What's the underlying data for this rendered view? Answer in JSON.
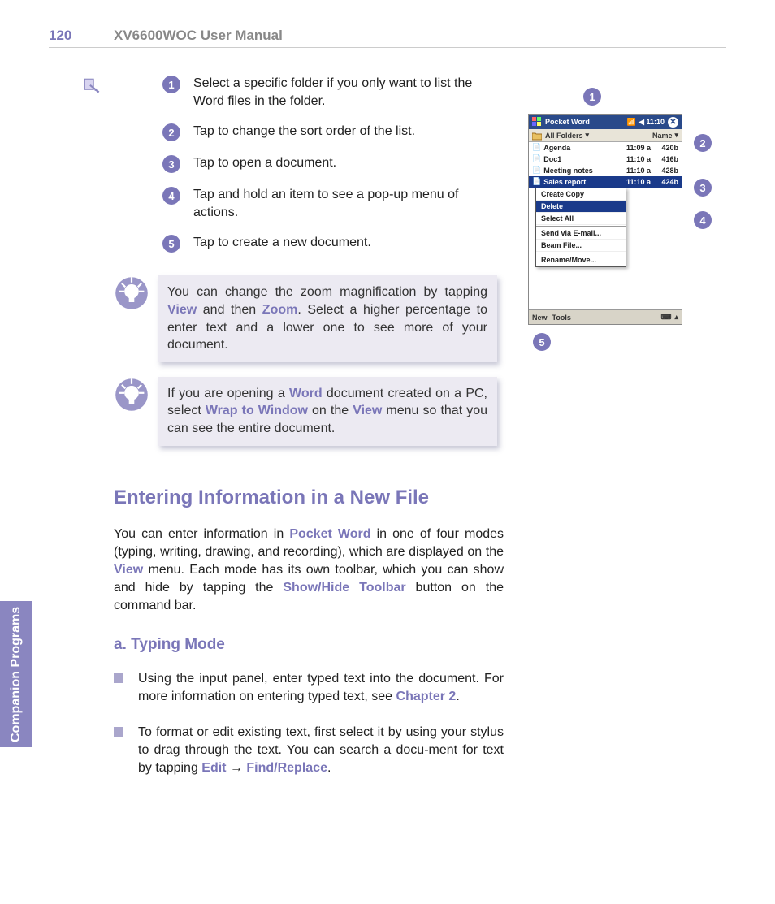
{
  "header": {
    "page_number": "120",
    "title": "XV6600WOC User Manual"
  },
  "side_tab": "Companion Programs",
  "steps": [
    "Select a specific folder if you only want to list the Word files in the folder.",
    "Tap to change the sort order of the list.",
    "Tap to open a document.",
    "Tap and hold an item to see a pop-up menu of actions.",
    "Tap to create a new document."
  ],
  "tips": {
    "tip1_pre": "You can change the zoom magnification by tapping ",
    "tip1_link1": "View",
    "tip1_mid": " and then ",
    "tip1_link2": "Zoom",
    "tip1_post": ". Select a higher percentage to enter text and a lower one to see more of  your document.",
    "tip2_pre": "If you are opening a ",
    "tip2_link1": "Word",
    "tip2_mid1": " document created on a PC, select ",
    "tip2_link2": "Wrap to Window",
    "tip2_mid2": " on the ",
    "tip2_link3": "View",
    "tip2_post": " menu so that you can see the entire document."
  },
  "section": {
    "title": "Entering Information in a New File",
    "para_pre": "You can enter information in ",
    "para_link1": "Pocket Word",
    "para_mid1": " in one of four modes (typing, writing, drawing, and recording), which are displayed on the ",
    "para_link2": "View",
    "para_mid2": " menu. Each mode has its own toolbar, which you can show and hide by tapping the ",
    "para_link3": "Show/Hide Toolbar",
    "para_post": " button on the command bar.",
    "subtitle": "a. Typing Mode",
    "bullets": [
      {
        "pre": "Using the input panel, enter typed text into the document. For more information on entering typed text, see ",
        "link": "Chapter 2",
        "post": "."
      },
      {
        "pre": "To format or edit existing text, first select it by using your stylus to drag through the text. You can search a docu-ment for text by tapping ",
        "link1": "Edit",
        "mid": "  →  ",
        "link2": "Find/Replace",
        "post": "."
      }
    ]
  },
  "device": {
    "title": "Pocket Word",
    "time_signal": "◀ 11:10",
    "folder_label": "All Folders",
    "sort_label": "Name",
    "files": [
      {
        "name": "Agenda",
        "time": "11:09 a",
        "size": "420b"
      },
      {
        "name": "Doc1",
        "time": "11:10 a",
        "size": "416b"
      },
      {
        "name": "Meeting notes",
        "time": "11:10 a",
        "size": "428b"
      },
      {
        "name": "Sales report",
        "time": "11:10 a",
        "size": "424b"
      }
    ],
    "popup": [
      "Create Copy",
      "Delete",
      "Select All",
      "Send via E-mail...",
      "Beam File...",
      "Rename/Move..."
    ],
    "bottombar": {
      "new": "New",
      "tools": "Tools"
    }
  },
  "callouts": [
    "1",
    "2",
    "3",
    "4",
    "5"
  ]
}
